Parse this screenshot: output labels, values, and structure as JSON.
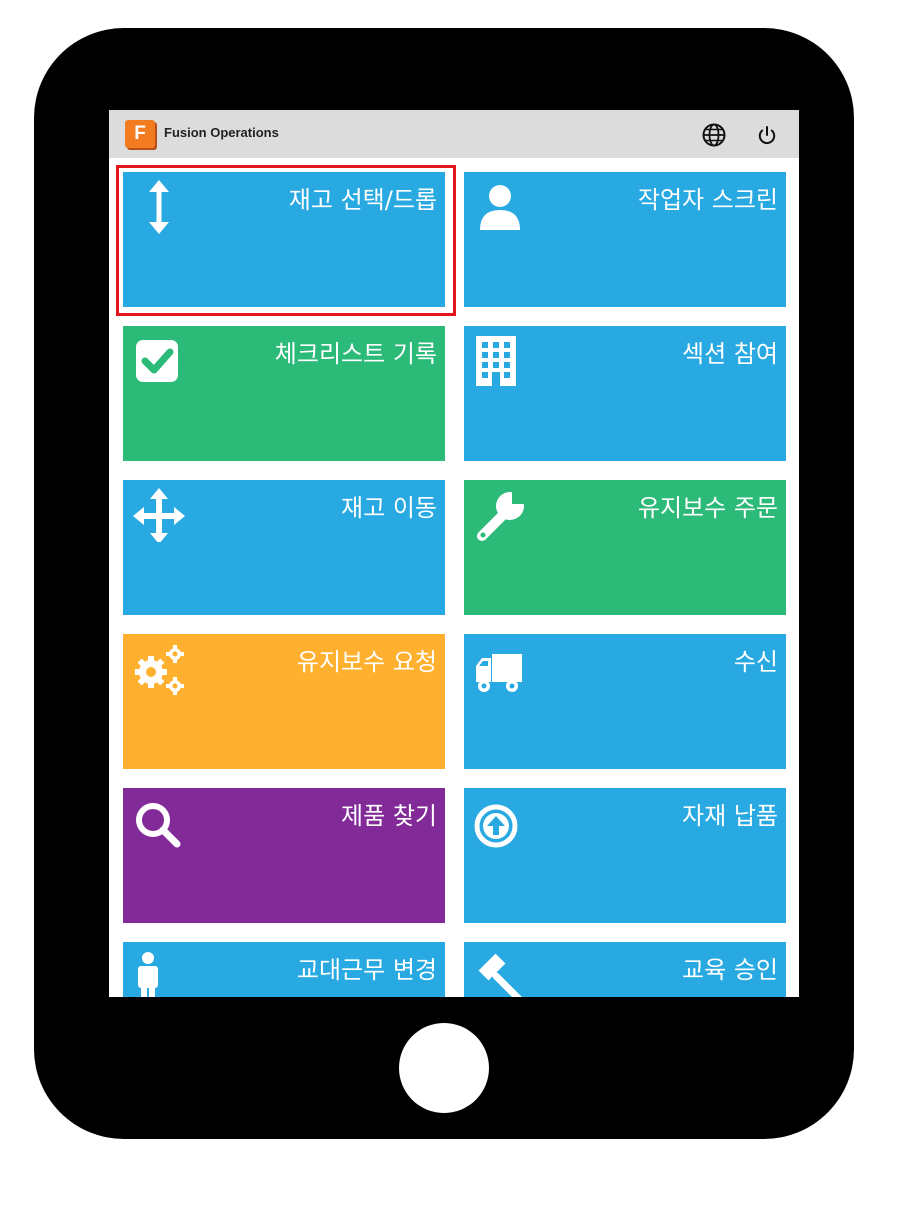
{
  "app": {
    "logo_letter": "F",
    "title": "Fusion Operations"
  },
  "header": {
    "globe_icon": "globe-icon",
    "power_icon": "power-icon"
  },
  "tiles": [
    {
      "label": "재고 선택/드롭",
      "icon": "vertical-arrows-icon",
      "color": "#28a9e1",
      "highlighted": true
    },
    {
      "label": "작업자 스크린",
      "icon": "user-icon",
      "color": "#28a9e1"
    },
    {
      "label": "체크리스트 기록",
      "icon": "checkbox-icon",
      "color": "#2bba78"
    },
    {
      "label": "섹션 참여",
      "icon": "building-icon",
      "color": "#28a9e1"
    },
    {
      "label": "재고 이동",
      "icon": "move-arrows-icon",
      "color": "#28a9e1"
    },
    {
      "label": "유지보수 주문",
      "icon": "wrench-icon",
      "color": "#2bba78"
    },
    {
      "label": "유지보수 요청",
      "icon": "gears-icon",
      "color": "#ffb02e"
    },
    {
      "label": "수신",
      "icon": "truck-icon",
      "color": "#28a9e1"
    },
    {
      "label": "제품 찾기",
      "icon": "search-icon",
      "color": "#832a99"
    },
    {
      "label": "자재 납품",
      "icon": "upload-circle-icon",
      "color": "#28a9e1"
    },
    {
      "label": "교대근무 변경",
      "icon": "person-icon",
      "color": "#28a9e1"
    },
    {
      "label": "교육 승인",
      "icon": "gavel-icon",
      "color": "#28a9e1"
    }
  ]
}
